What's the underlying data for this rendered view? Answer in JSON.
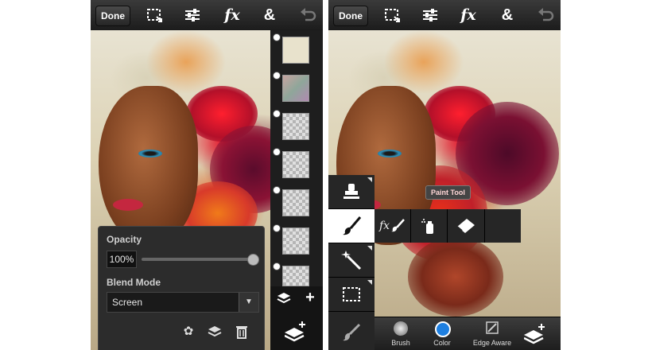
{
  "left_screen": {
    "toolbar": {
      "done_label": "Done",
      "icons": [
        "selection-icon",
        "adjustments-icon",
        "fx-icon",
        "ampersand-icon",
        "undo-icon"
      ],
      "fx_label": "fx",
      "amp_label": "&"
    },
    "layers": {
      "thumbnail_count": 7,
      "add_label": "+"
    },
    "layer_panel": {
      "opacity_label": "Opacity",
      "opacity_value": "100%",
      "opacity_level": 1.0,
      "blend_mode_label": "Blend Mode",
      "blend_mode_value": "Screen",
      "actions": [
        "layer-style-icon",
        "merge-down-icon",
        "trash-icon"
      ]
    }
  },
  "right_screen": {
    "toolbar": {
      "done_label": "Done",
      "fx_label": "fx",
      "amp_label": "&"
    },
    "tools": [
      "stamp-icon",
      "brush-icon",
      "magic-wand-icon",
      "marquee-icon",
      "smudge-icon"
    ],
    "tooltip": "Paint Tool",
    "paint_options": [
      "fx-brush-icon",
      "brush-icon",
      "spray-can-icon",
      "eraser-icon"
    ],
    "paint_fx_label": "fx",
    "bottom": {
      "brush_label": "Brush",
      "color_label": "Color",
      "edge_aware_label": "Edge Aware"
    },
    "colors": {
      "color_swatch": "#1e7fe0"
    }
  }
}
